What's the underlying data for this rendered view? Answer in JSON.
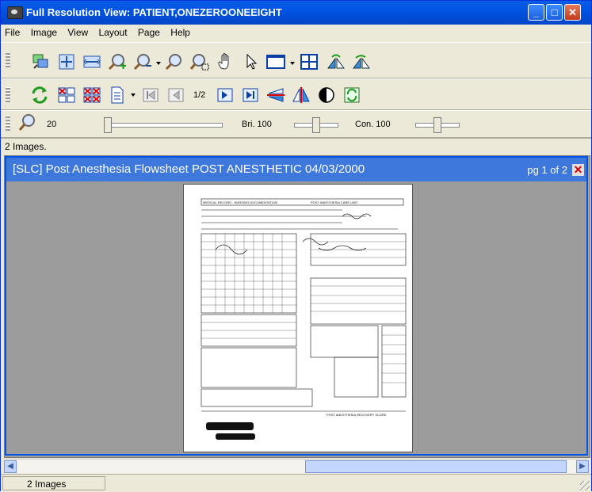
{
  "window": {
    "title": "Full Resolution View: PATIENT,ONEZEROONEEIGHT"
  },
  "menu": [
    "File",
    "Image",
    "View",
    "Layout",
    "Page",
    "Help"
  ],
  "toolbar1": {
    "icons": [
      "stack-images-icon",
      "fit-to-window-icon",
      "fit-to-width-icon",
      "zoom-in-icon",
      "zoom-out-icon",
      "zoom-rect-icon",
      "zoom-select-icon",
      "pan-hand-icon",
      "pointer-icon",
      "window-layout-icon",
      "grid-layout-icon",
      "flip-horizontal-icon",
      "rotate-icon"
    ]
  },
  "toolbar2": {
    "page_indicator": "1/2",
    "icons": [
      "refresh-icon",
      "remove-image-icon",
      "remove-all-icon",
      "document-icon",
      "first-page-icon",
      "prev-page-icon",
      "next-page-icon",
      "last-page-icon",
      "flip-vertical-icon",
      "mirror-icon",
      "contrast-icon",
      "reload-icon"
    ]
  },
  "toolbar3": {
    "zoom_value": "20",
    "brightness_label": "Bri. 100",
    "contrast_label": "Con. 100",
    "zoom_level": 0.0,
    "brightness_level": 0.5,
    "contrast_level": 0.5
  },
  "info": {
    "text": "2 Images."
  },
  "viewer": {
    "title": "[SLC] Post Anesthesia Flowsheet POST ANESTHETIC 04/03/2000",
    "page": "pg 1 of 2",
    "close": "✕"
  },
  "status": {
    "text": "2 Images"
  },
  "colors": {
    "title_blue": "#0054e3",
    "viewer_header": "#3f78dc",
    "close_red": "#c4381a"
  }
}
